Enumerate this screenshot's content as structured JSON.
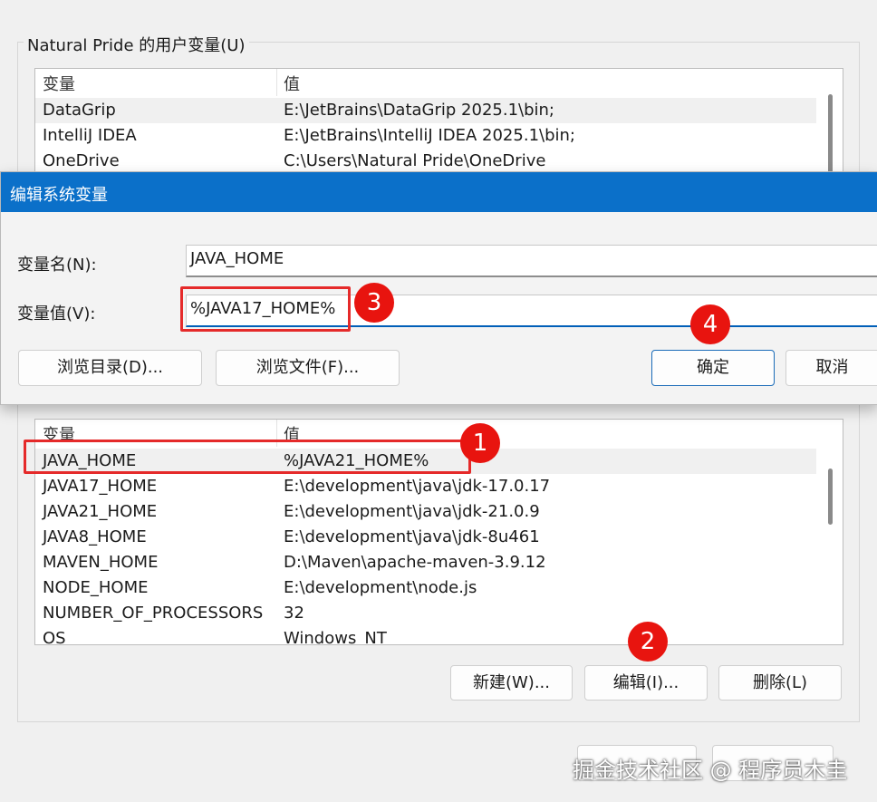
{
  "user_vars": {
    "group_title": "Natural Pride 的用户变量(U)",
    "col_var": "变量",
    "col_val": "值",
    "rows": [
      {
        "name": "DataGrip",
        "value": "E:\\JetBrains\\DataGrip 2025.1\\bin;"
      },
      {
        "name": "IntelliJ IDEA",
        "value": "E:\\JetBrains\\IntelliJ IDEA 2025.1\\bin;"
      },
      {
        "name": "OneDrive",
        "value": "C:\\Users\\Natural Pride\\OneDrive"
      }
    ]
  },
  "dialog": {
    "title": "编辑系统变量",
    "name_label": "变量名(N):",
    "name_value": "JAVA_HOME",
    "value_label": "变量值(V):",
    "value_value": "%JAVA17_HOME%",
    "browse_dir": "浏览目录(D)...",
    "browse_file": "浏览文件(F)...",
    "ok": "确定",
    "cancel": "取消"
  },
  "system_vars": {
    "col_var": "变量",
    "col_val": "值",
    "rows": [
      {
        "name": "JAVA_HOME",
        "value": "%JAVA21_HOME%"
      },
      {
        "name": "JAVA17_HOME",
        "value": "E:\\development\\java\\jdk-17.0.17"
      },
      {
        "name": "JAVA21_HOME",
        "value": "E:\\development\\java\\jdk-21.0.9"
      },
      {
        "name": "JAVA8_HOME",
        "value": "E:\\development\\java\\jdk-8u461"
      },
      {
        "name": "MAVEN_HOME",
        "value": "D:\\Maven\\apache-maven-3.9.12"
      },
      {
        "name": "NODE_HOME",
        "value": "E:\\development\\node.js"
      },
      {
        "name": "NUMBER_OF_PROCESSORS",
        "value": "32"
      },
      {
        "name": "OS",
        "value": "Windows_NT"
      }
    ],
    "new_btn": "新建(W)...",
    "edit_btn": "编辑(I)...",
    "delete_btn": "删除(L)"
  },
  "annotations": {
    "b1": "1",
    "b2": "2",
    "b3": "3",
    "b4": "4",
    "badge_color": "#e8140f"
  },
  "watermark": "掘金技术社区 @ 程序员木圭"
}
